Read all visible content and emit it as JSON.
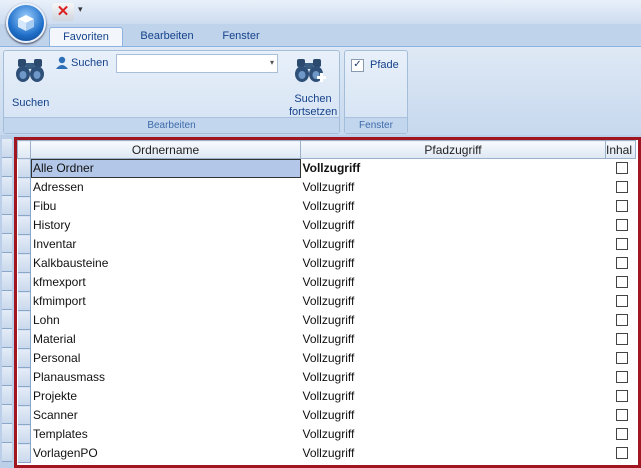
{
  "tabs": [
    "Favoriten",
    "Bearbeiten",
    "Fenster"
  ],
  "ribbon": {
    "search_big_label": "Suchen",
    "search_small_label": "Suchen",
    "search_combo_value": "",
    "continue_line1": "Suchen",
    "continue_line2": "fortsetzen",
    "group_edit_label": "Bearbeiten",
    "pfade_label": "Pfade",
    "pfade_checked": true,
    "group_window_label": "Fenster"
  },
  "grid": {
    "columns": [
      "Ordnername",
      "Pfadzugriff",
      "Inhal"
    ],
    "rows": [
      {
        "name": "Alle Ordner",
        "access": "Vollzugriff"
      },
      {
        "name": "Adressen",
        "access": "Vollzugriff"
      },
      {
        "name": "Fibu",
        "access": "Vollzugriff"
      },
      {
        "name": "History",
        "access": "Vollzugriff"
      },
      {
        "name": "Inventar",
        "access": "Vollzugriff"
      },
      {
        "name": "Kalkbausteine",
        "access": "Vollzugriff"
      },
      {
        "name": "kfmexport",
        "access": "Vollzugriff"
      },
      {
        "name": "kfmimport",
        "access": "Vollzugriff"
      },
      {
        "name": "Lohn",
        "access": "Vollzugriff"
      },
      {
        "name": "Material",
        "access": "Vollzugriff"
      },
      {
        "name": "Personal",
        "access": "Vollzugriff"
      },
      {
        "name": "Planausmass",
        "access": "Vollzugriff"
      },
      {
        "name": "Projekte",
        "access": "Vollzugriff"
      },
      {
        "name": "Scanner",
        "access": "Vollzugriff"
      },
      {
        "name": "Templates",
        "access": "Vollzugriff"
      },
      {
        "name": "VorlagenPO",
        "access": "Vollzugriff"
      }
    ]
  },
  "colors": {
    "frame": "#a01520",
    "selection": "#b3c8e8"
  }
}
